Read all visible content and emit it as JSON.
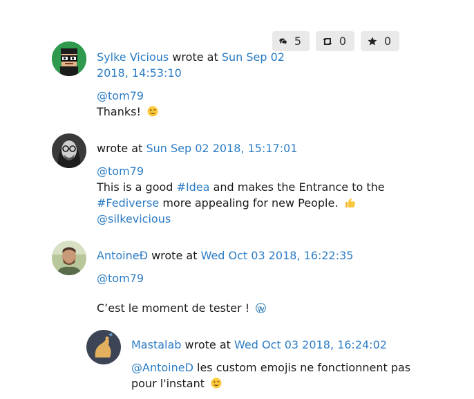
{
  "stats": {
    "comments": "5",
    "reshares": "0",
    "stars": "0"
  },
  "posts": [
    {
      "author": "Sylke Vicious",
      "wrote_at": "wrote at",
      "timestamp_line1": "Sun Sep 02",
      "timestamp_line2": "2018, 14:53:10",
      "mention": "@tom79",
      "text": "Thanks!",
      "emoji": "winking-face"
    },
    {
      "author": "",
      "wrote_at": "wrote at",
      "timestamp": "Sun Sep 02 2018, 15:17:01",
      "mention": "@tom79",
      "text_a": "This is a good",
      "hashtag1": "#Idea",
      "text_b": "and makes the Entrance to the",
      "hashtag2": "#Fediverse",
      "text_c": "more appealing for new People.",
      "emoji": "thumbs-up",
      "mention2": "@silkevicious"
    },
    {
      "author": "AntoineÐ",
      "wrote_at": "wrote at",
      "timestamp": "Wed Oct 03 2018, 16:22:35",
      "mention": "@tom79",
      "text": "C’est le moment de tester !",
      "emoji": "wordpress-logo"
    },
    {
      "author": "Mastalab",
      "wrote_at": "wrote at",
      "timestamp": "Wed Oct 03 2018, 16:24:02",
      "mention": "@AntoineD",
      "text_a": "les custom emojis ne fonctionnent pas",
      "text_b": "pour l'instant",
      "emoji": "winking-face"
    }
  ],
  "colors": {
    "link": "#2b7cc4",
    "stat_bg": "#e9e9e9",
    "text": "#1a1a1a"
  }
}
